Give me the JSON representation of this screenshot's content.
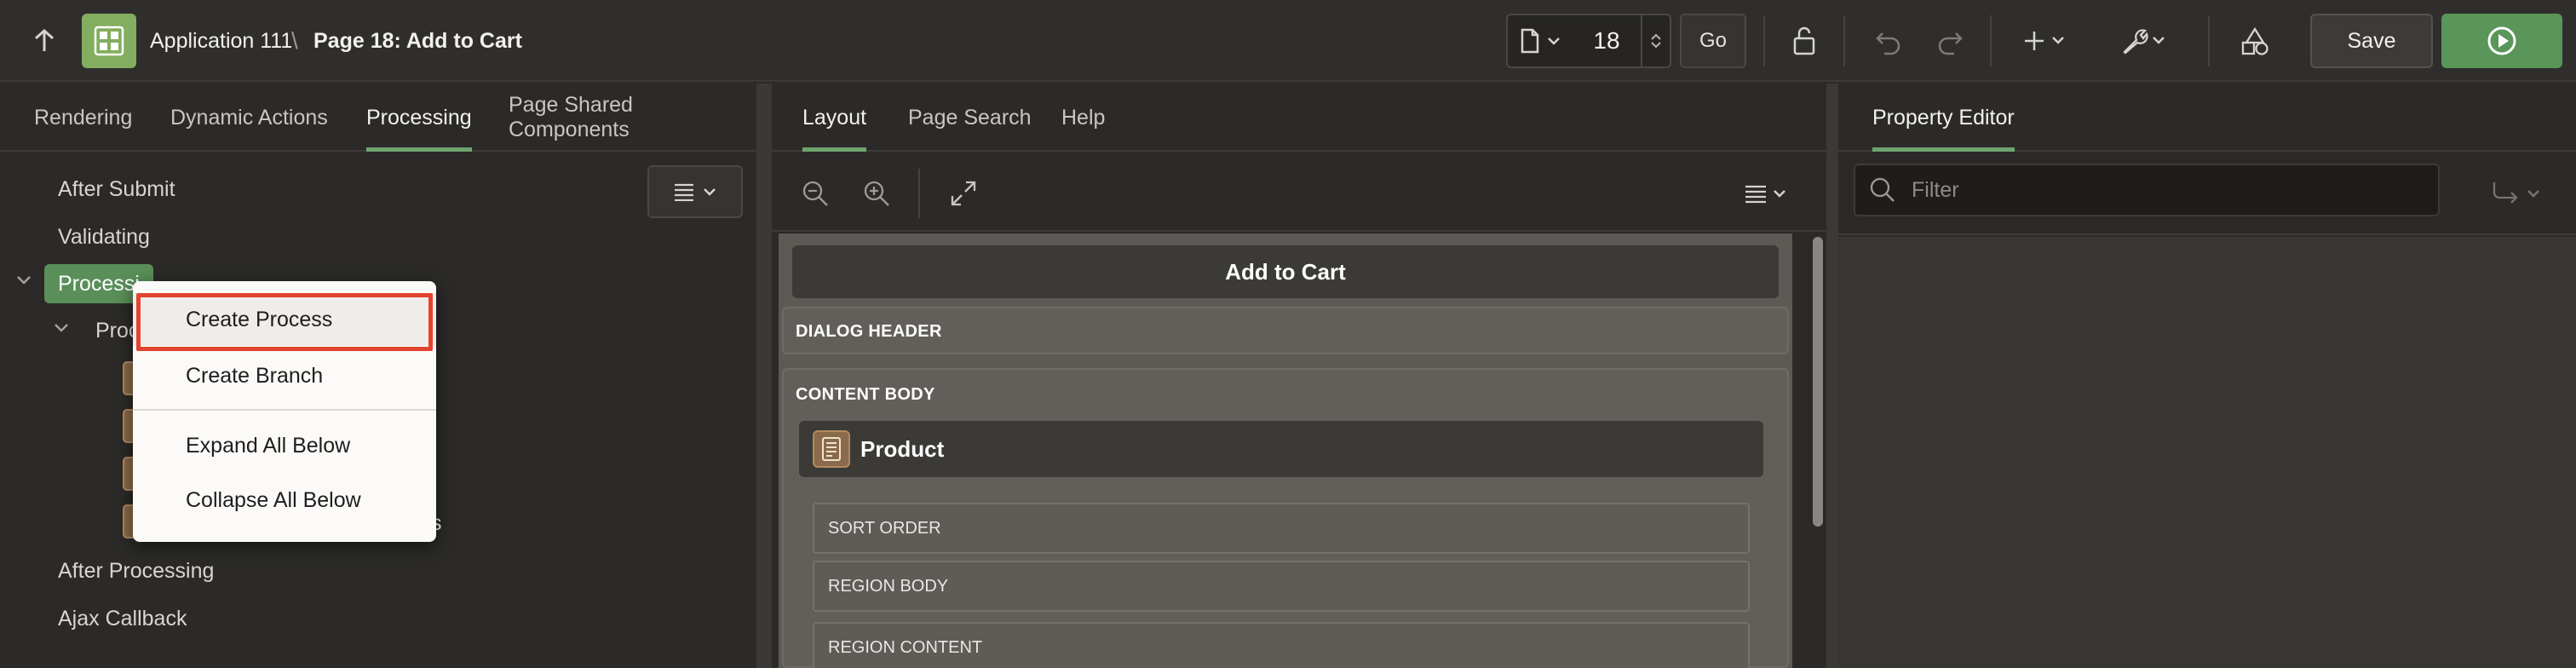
{
  "header": {
    "app_name": "Application 111",
    "page_title": "Page 18: Add to Cart",
    "page_number": "18",
    "go_label": "Go",
    "save_label": "Save"
  },
  "left": {
    "tabs": [
      "Rendering",
      "Dynamic Actions",
      "Processing",
      "Page Shared Components"
    ],
    "active_tab": "Processing",
    "tree": {
      "after_submit": "After Submit",
      "validating": "Validating",
      "processing": "Processi",
      "processes_partial": "Proc",
      "process_tail": "s",
      "after_processing": "After Processing",
      "ajax_callback": "Ajax Callback"
    }
  },
  "context_menu": {
    "items": [
      "Create Process",
      "Create Branch",
      "Expand All Below",
      "Collapse All Below"
    ]
  },
  "middle": {
    "tabs": [
      "Layout",
      "Page Search",
      "Help"
    ],
    "active_tab": "Layout",
    "dialog_title": "Add to Cart",
    "dialog_header": "DIALOG HEADER",
    "content_body": "CONTENT BODY",
    "region_title": "Product",
    "slots": [
      "SORT ORDER",
      "REGION BODY",
      "REGION CONTENT"
    ]
  },
  "right": {
    "tab": "Property Editor",
    "filter_placeholder": "Filter"
  },
  "colors": {
    "accent_green": "#5a9559",
    "highlight_red": "#e2432f",
    "process_brown": "#8a6a4a"
  }
}
